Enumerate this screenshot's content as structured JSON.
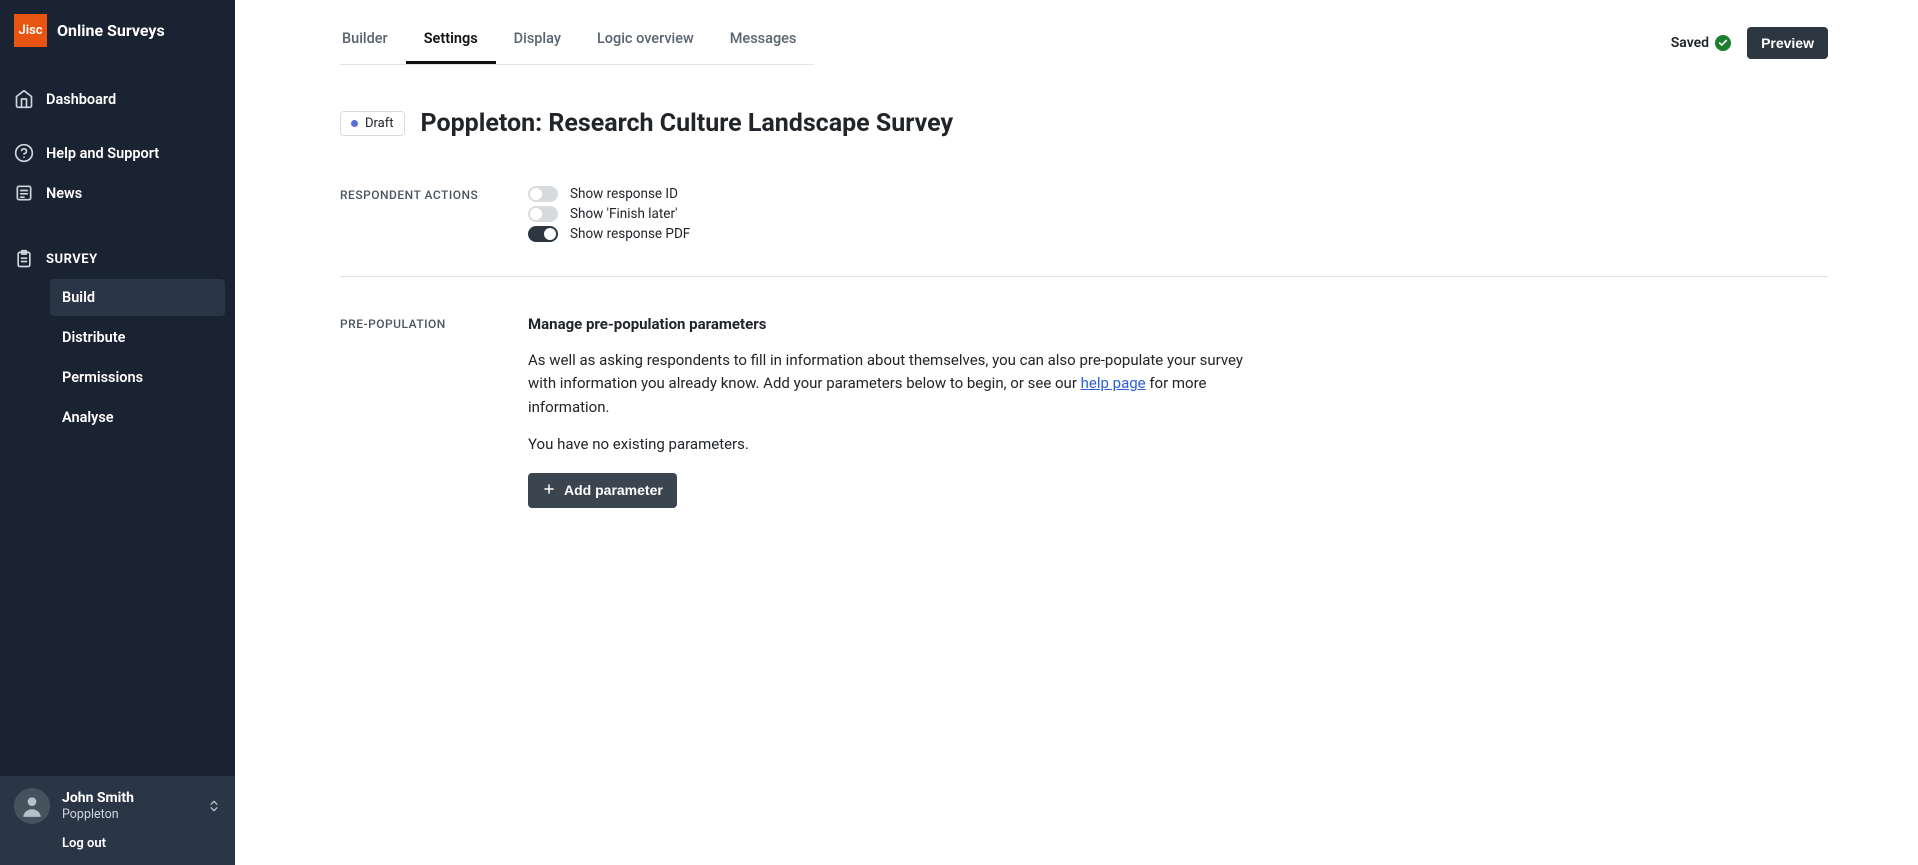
{
  "sidebar": {
    "brand": "Jisc",
    "title": "Online Surveys",
    "nav": {
      "dashboard": "Dashboard",
      "help": "Help and Support",
      "news": "News"
    },
    "section_label": "SURVEY",
    "survey_items": {
      "build": "Build",
      "distribute": "Distribute",
      "permissions": "Permissions",
      "analyse": "Analyse"
    },
    "user": {
      "name": "John Smith",
      "org": "Poppleton",
      "logout": "Log out"
    }
  },
  "tabs": {
    "builder": "Builder",
    "settings": "Settings",
    "display": "Display",
    "logic": "Logic overview",
    "messages": "Messages"
  },
  "topbar": {
    "saved": "Saved",
    "preview": "Preview"
  },
  "header": {
    "badge": "Draft",
    "title": "Poppleton: Research Culture Landscape Survey"
  },
  "respondent_actions": {
    "label": "RESPONDENT ACTIONS",
    "items": [
      {
        "label": "Show response ID",
        "on": false
      },
      {
        "label": "Show 'Finish later'",
        "on": false
      },
      {
        "label": "Show response PDF",
        "on": true
      }
    ]
  },
  "prepop": {
    "label": "PRE-POPULATION",
    "title": "Manage pre-population parameters",
    "text_a": "As well as asking respondents to fill in information about themselves, you can also pre-populate your survey with information you already know. Add your parameters below to begin, or see our ",
    "link": "help page",
    "text_b": " for more information.",
    "no_params": "You have no existing parameters.",
    "add_btn": "Add parameter"
  }
}
